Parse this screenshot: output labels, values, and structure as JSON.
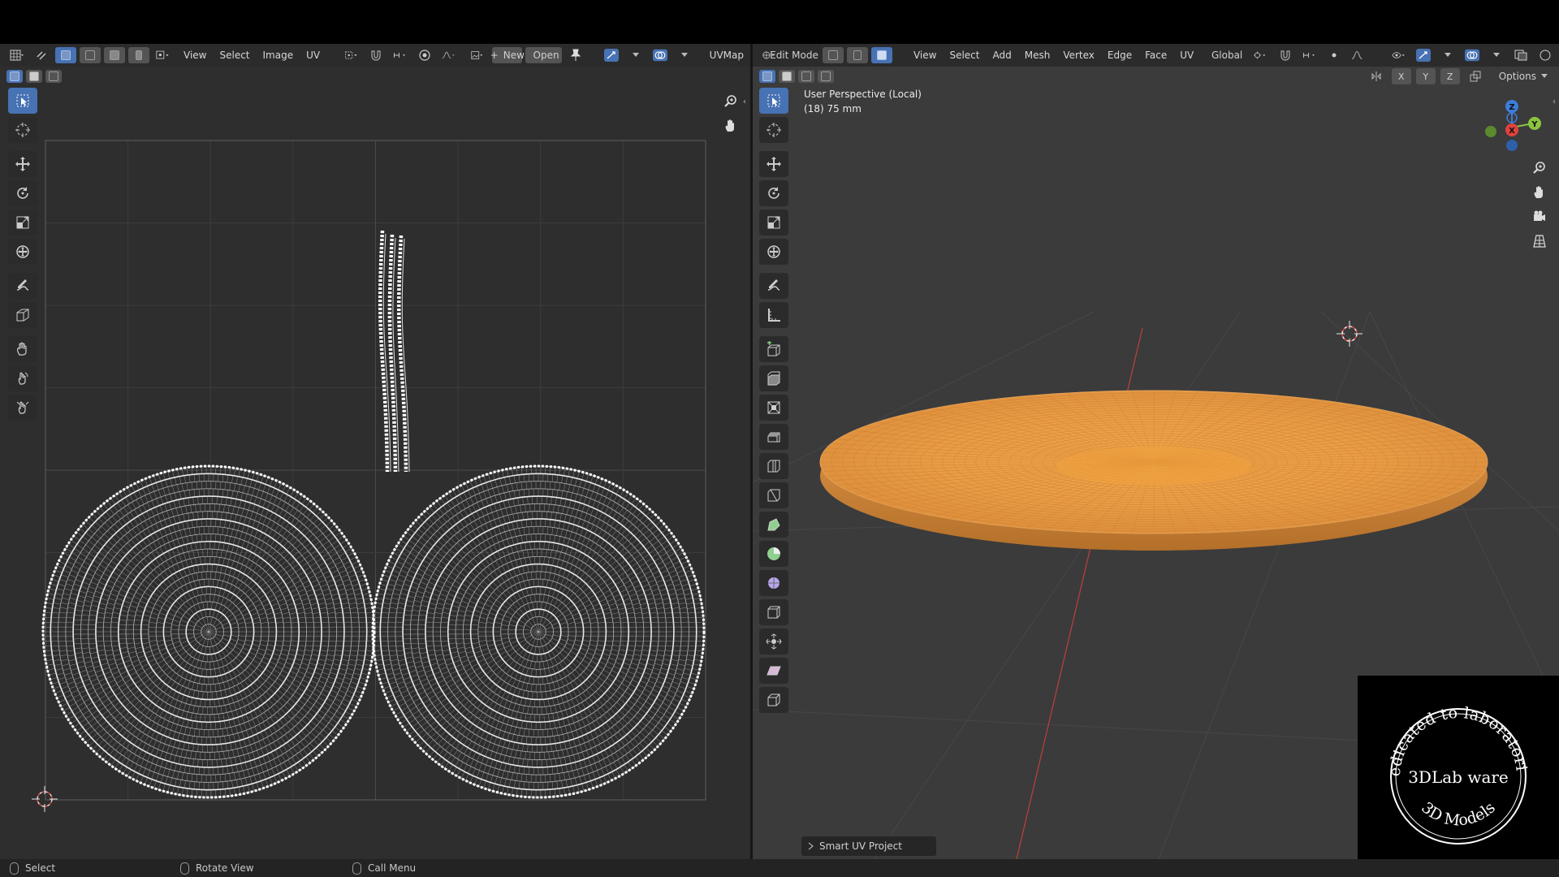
{
  "uv_editor": {
    "header": {
      "menus": [
        "View",
        "Select",
        "Image",
        "UV"
      ],
      "new_label": "New",
      "open_label": "Open",
      "uvmap_name": "UVMap"
    }
  },
  "viewport": {
    "header": {
      "mode": "Edit Mode",
      "menus": [
        "View",
        "Select",
        "Add",
        "Mesh",
        "Vertex",
        "Edge",
        "Face",
        "UV"
      ],
      "transform_orientation": "Global"
    },
    "axis_buttons": [
      "X",
      "Y",
      "Z"
    ],
    "options_label": "Options",
    "info_line1": "User Perspective (Local)",
    "info_line2": "(18) 75 mm",
    "gizmo_labels": [
      "Z",
      "X",
      "Y"
    ],
    "last_operator": "Smart UV Project"
  },
  "statusbar": {
    "select": "Select",
    "rotate": "Rotate View",
    "menu": "Call Menu"
  },
  "watermark": {
    "top_arc": "Dedicated to laboratories",
    "middle": "3DLab ware",
    "bottom_arc": "3D Models"
  },
  "colors": {
    "accent": "#4772b3",
    "plate": "#e8963c",
    "uv_wire": "#ffffff",
    "x_axis": "#e0423c",
    "y_axis": "#8bc43f",
    "z_axis": "#3d7ddb"
  }
}
